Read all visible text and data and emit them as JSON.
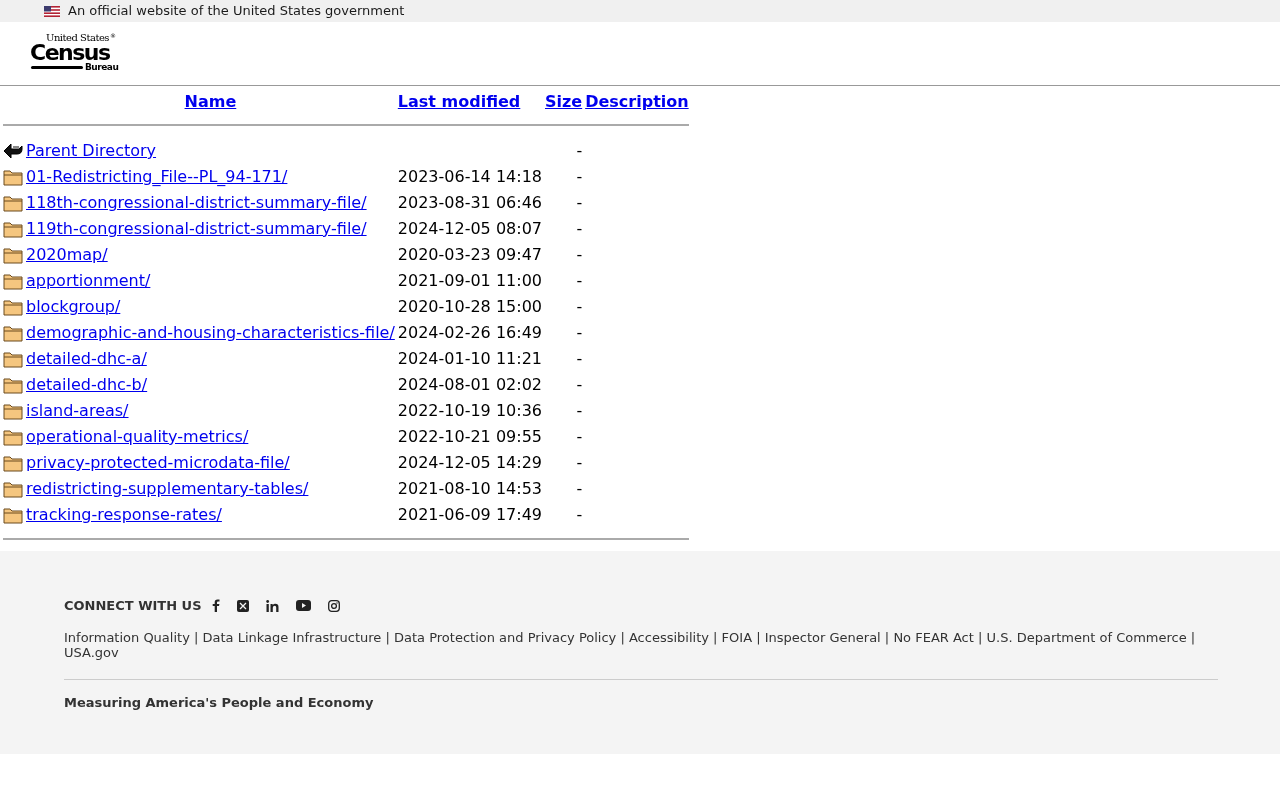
{
  "gov_banner": {
    "text": "An official website of the United States government"
  },
  "logo": {
    "line_1": "United States",
    "mark": "®",
    "line_2": "Census",
    "line_3": "Bureau"
  },
  "table": {
    "columns": [
      "Name",
      "Last modified",
      "Size",
      "Description"
    ],
    "rows": [
      {
        "kind": "parent",
        "name": "Parent Directory",
        "modified": "",
        "size": "-"
      },
      {
        "kind": "folder",
        "name": "01-Redistricting_File--PL_94-171/",
        "modified": "2023-06-14 14:18",
        "size": "-"
      },
      {
        "kind": "folder",
        "name": "118th-congressional-district-summary-file/",
        "modified": "2023-08-31 06:46",
        "size": "-"
      },
      {
        "kind": "folder",
        "name": "119th-congressional-district-summary-file/",
        "modified": "2024-12-05 08:07",
        "size": "-"
      },
      {
        "kind": "folder",
        "name": "2020map/",
        "modified": "2020-03-23 09:47",
        "size": "-"
      },
      {
        "kind": "folder",
        "name": "apportionment/",
        "modified": "2021-09-01 11:00",
        "size": "-"
      },
      {
        "kind": "folder",
        "name": "blockgroup/",
        "modified": "2020-10-28 15:00",
        "size": "-"
      },
      {
        "kind": "folder",
        "name": "demographic-and-housing-characteristics-file/",
        "modified": "2024-02-26 16:49",
        "size": "-"
      },
      {
        "kind": "folder",
        "name": "detailed-dhc-a/",
        "modified": "2024-01-10 11:21",
        "size": "-"
      },
      {
        "kind": "folder",
        "name": "detailed-dhc-b/",
        "modified": "2024-08-01 02:02",
        "size": "-"
      },
      {
        "kind": "folder",
        "name": "island-areas/",
        "modified": "2022-10-19 10:36",
        "size": "-"
      },
      {
        "kind": "folder",
        "name": "operational-quality-metrics/",
        "modified": "2022-10-21 09:55",
        "size": "-"
      },
      {
        "kind": "folder",
        "name": "privacy-protected-microdata-file/",
        "modified": "2024-12-05 14:29",
        "size": "-"
      },
      {
        "kind": "folder",
        "name": "redistricting-supplementary-tables/",
        "modified": "2021-08-10 14:53",
        "size": "-"
      },
      {
        "kind": "folder",
        "name": "tracking-response-rates/",
        "modified": "2021-06-09 17:49",
        "size": "-"
      }
    ]
  },
  "footer": {
    "connect_label": "CONNECT WITH US",
    "social": [
      {
        "kind": "facebook"
      },
      {
        "kind": "x"
      },
      {
        "kind": "linkedin"
      },
      {
        "kind": "youtube"
      },
      {
        "kind": "instagram"
      }
    ],
    "links": [
      {
        "label": "Information Quality",
        "separator": "|"
      },
      {
        "label": "Data Linkage Infrastructure",
        "separator": "|"
      },
      {
        "label": "Data Protection and Privacy Policy",
        "separator": "|"
      },
      {
        "label": "Accessibility",
        "separator": "|"
      },
      {
        "label": "FOIA",
        "separator": "|"
      },
      {
        "label": "Inspector General",
        "separator": "|"
      },
      {
        "label": "No FEAR Act",
        "separator": "|"
      },
      {
        "label": "U.S. Department of Commerce",
        "separator": "|"
      },
      {
        "label": "USA.gov"
      }
    ],
    "tagline": "Measuring America's People and Economy"
  }
}
